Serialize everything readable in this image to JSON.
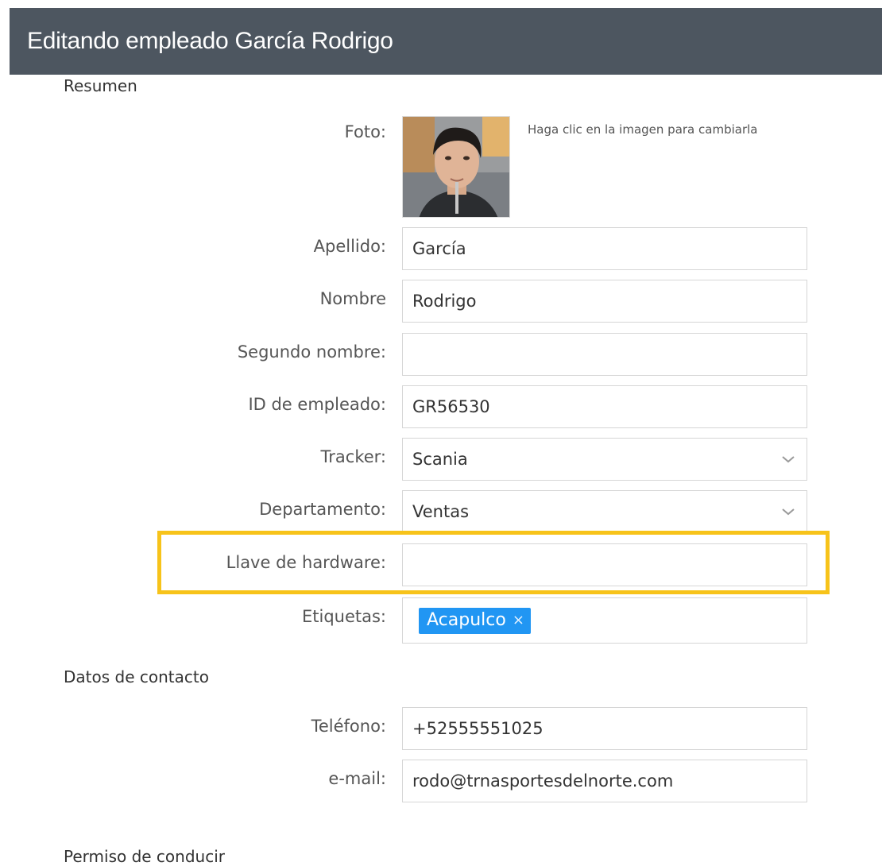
{
  "header": {
    "title": "Editando empleado García Rodrigo"
  },
  "sections": {
    "summary": "Resumen",
    "contact": "Datos de contacto",
    "license": "Permiso de conducir"
  },
  "photo": {
    "label": "Foto:",
    "hint": "Haga clic en la imagen para cambiarla"
  },
  "fields": {
    "last_name": {
      "label": "Apellido:",
      "value": "García"
    },
    "first_name": {
      "label": "Nombre",
      "value": "Rodrigo"
    },
    "middle_name": {
      "label": "Segundo nombre:",
      "value": ""
    },
    "employee_id": {
      "label": "ID de empleado:",
      "value": "GR56530"
    },
    "tracker": {
      "label": "Tracker:",
      "value": "Scania"
    },
    "department": {
      "label": "Departamento:",
      "value": "Ventas"
    },
    "hardware_key": {
      "label": "Llave de hardware:",
      "value": ""
    },
    "tags": {
      "label": "Etiquetas:",
      "items": [
        "Acapulco"
      ],
      "remove_symbol": "×"
    },
    "phone": {
      "label": "Teléfono:",
      "value": "+52555551025"
    },
    "email": {
      "label": "e-mail:",
      "value": "rodo@trnasportesdelnorte.com"
    }
  },
  "colors": {
    "header_bg": "#4d5660",
    "highlight": "#f7c31a",
    "tag_bg": "#2196f3"
  },
  "icons": {
    "dropdown": "chevron-down-icon",
    "remove_tag": "close-icon"
  }
}
